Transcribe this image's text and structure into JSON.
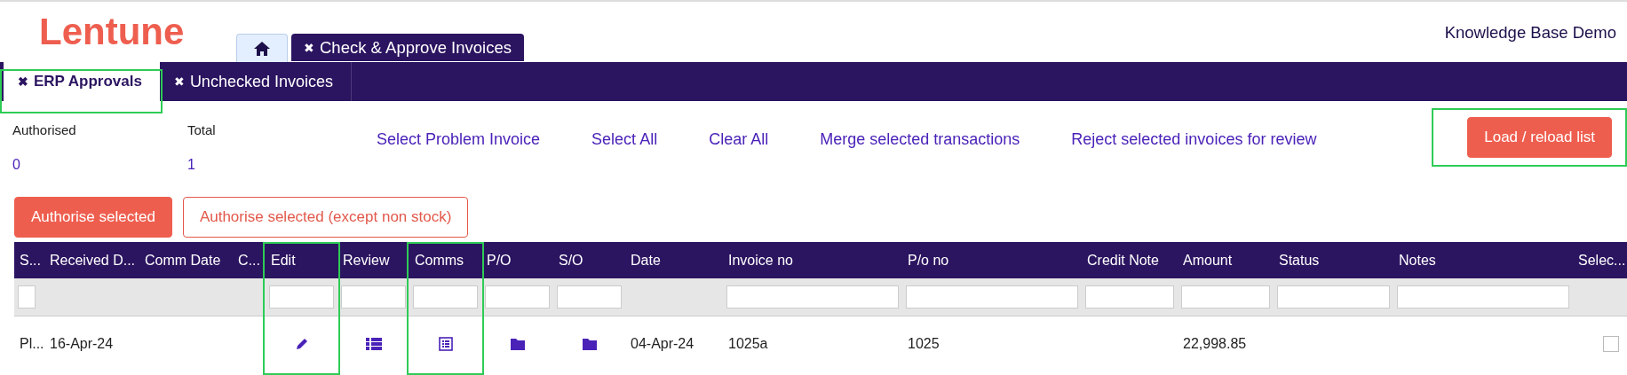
{
  "logo": "Lentune",
  "user": "Knowledge Base Demo",
  "top_tabs": [
    {
      "kind": "home",
      "selected": false
    },
    {
      "kind": "text",
      "label": "Check & Approve Invoices",
      "close": "✖",
      "selected": true
    }
  ],
  "sub_tabs": [
    {
      "label": "ERP Approvals",
      "close": "✖",
      "selected": true,
      "highlighted": true
    },
    {
      "label": "Unchecked Invoices",
      "close": "✖",
      "selected": false,
      "highlighted": false
    }
  ],
  "stats": [
    {
      "label": "Authorised",
      "value": "0"
    },
    {
      "label": "Total",
      "value": "1"
    }
  ],
  "links": [
    "Select Problem Invoice",
    "Select All",
    "Clear All",
    "Merge selected transactions",
    "Reject selected invoices for review"
  ],
  "reload_button": {
    "label": "Load / reload list",
    "highlighted": true
  },
  "actions": [
    {
      "label": "Authorise selected",
      "kind": "filled"
    },
    {
      "label": "Authorise selected (except non stock)",
      "kind": "outline"
    }
  ],
  "table": {
    "columns": [
      {
        "label": "S...",
        "filter": true,
        "highlighted": false
      },
      {
        "label": "Received D...",
        "filter": false,
        "highlighted": false
      },
      {
        "label": "Comm Date",
        "filter": false,
        "highlighted": false
      },
      {
        "label": "C...",
        "filter": false,
        "highlighted": false
      },
      {
        "label": "Edit",
        "filter": true,
        "highlighted": true
      },
      {
        "label": "Review",
        "filter": true,
        "highlighted": false
      },
      {
        "label": "Comms",
        "filter": true,
        "highlighted": true
      },
      {
        "label": "P/O",
        "filter": true,
        "highlighted": false
      },
      {
        "label": "S/O",
        "filter": true,
        "highlighted": false
      },
      {
        "label": "Date",
        "filter": false,
        "highlighted": false
      },
      {
        "label": "Invoice no",
        "filter": true,
        "highlighted": false
      },
      {
        "label": "P/o no",
        "filter": true,
        "highlighted": false
      },
      {
        "label": "Credit Note",
        "filter": true,
        "highlighted": false
      },
      {
        "label": "Amount",
        "filter": true,
        "highlighted": false
      },
      {
        "label": "Status",
        "filter": true,
        "highlighted": false
      },
      {
        "label": "Notes",
        "filter": true,
        "highlighted": false
      },
      {
        "label": "Selec...",
        "filter": false,
        "highlighted": false
      }
    ],
    "rows": [
      {
        "cells": [
          {
            "kind": "text",
            "text": "Pl..."
          },
          {
            "kind": "text",
            "text": "16-Apr-24"
          },
          {
            "kind": "empty"
          },
          {
            "kind": "empty"
          },
          {
            "kind": "pencil"
          },
          {
            "kind": "list"
          },
          {
            "kind": "document"
          },
          {
            "kind": "folder"
          },
          {
            "kind": "folder"
          },
          {
            "kind": "text",
            "text": "04-Apr-24"
          },
          {
            "kind": "text",
            "text": "1025a"
          },
          {
            "kind": "text",
            "text": "1025"
          },
          {
            "kind": "empty"
          },
          {
            "kind": "text",
            "text": "22,998.85"
          },
          {
            "kind": "empty"
          },
          {
            "kind": "empty"
          },
          {
            "kind": "checkbox",
            "checked": false
          }
        ]
      }
    ]
  }
}
